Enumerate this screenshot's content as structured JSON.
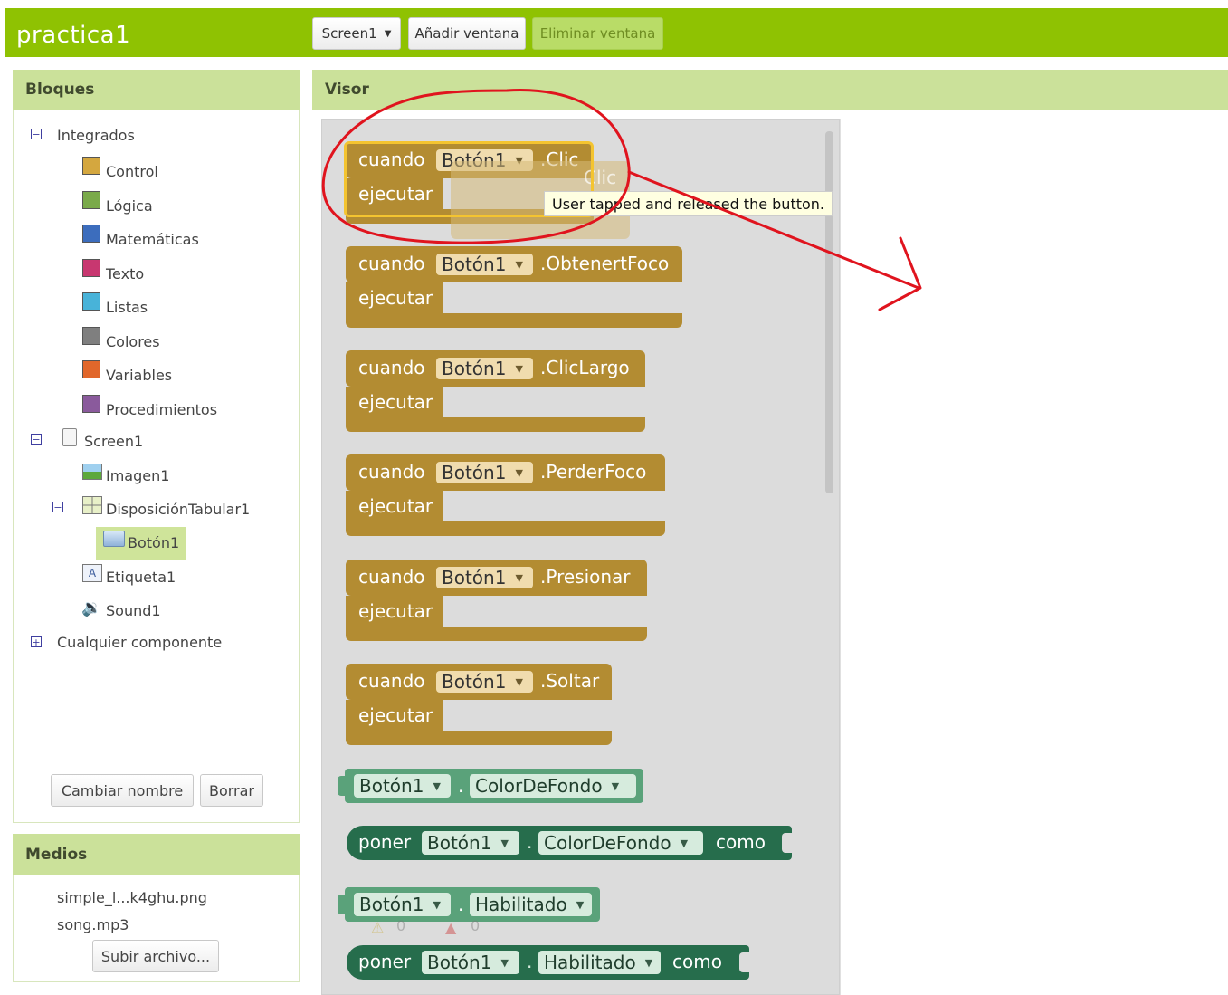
{
  "app": {
    "title": "practica1"
  },
  "toolbar": {
    "screen_select": "Screen1",
    "add_screen": "Añadir ventana",
    "remove_screen": "Eliminar ventana"
  },
  "blocks_panel": {
    "title": "Bloques",
    "builtin": {
      "label": "Integrados",
      "items": [
        "Control",
        "Lógica",
        "Matemáticas",
        "Texto",
        "Listas",
        "Colores",
        "Variables",
        "Procedimientos"
      ]
    },
    "builtin_colors": [
      "#d4a73f",
      "#7aaa4a",
      "#3c6dbd",
      "#c83770",
      "#48b3d9",
      "#7f7f7f",
      "#e1672b",
      "#8a5a9c"
    ],
    "screen": {
      "label": "Screen1",
      "image": "Imagen1",
      "table": "DisposiciónTabular1",
      "button": "Botón1",
      "label_comp": "Etiqueta1",
      "sound": "Sound1"
    },
    "any_component": "Cualquier componente",
    "rename_button": "Cambiar nombre",
    "delete_button": "Borrar"
  },
  "media_panel": {
    "title": "Medios",
    "files": [
      "simple_l...k4ghu.png",
      "song.mp3"
    ],
    "upload_button": "Subir archivo..."
  },
  "viewer": {
    "title": "Visor"
  },
  "blocks": {
    "when": "cuando",
    "do": "ejecutar",
    "component": "Botón1",
    "events": [
      ".Clic",
      ".ObtenertFoco",
      ".ClicLargo",
      ".PerderFoco",
      ".Presionar",
      ".Soltar"
    ],
    "set": "poner",
    "to": "como",
    "dot": ".",
    "prop_background": "ColorDeFondo",
    "prop_enabled": "Habilitado",
    "tooltip": "User tapped and released the button.",
    "ghost_event": "Clic",
    "warning_count": "0",
    "error_count": "0"
  }
}
